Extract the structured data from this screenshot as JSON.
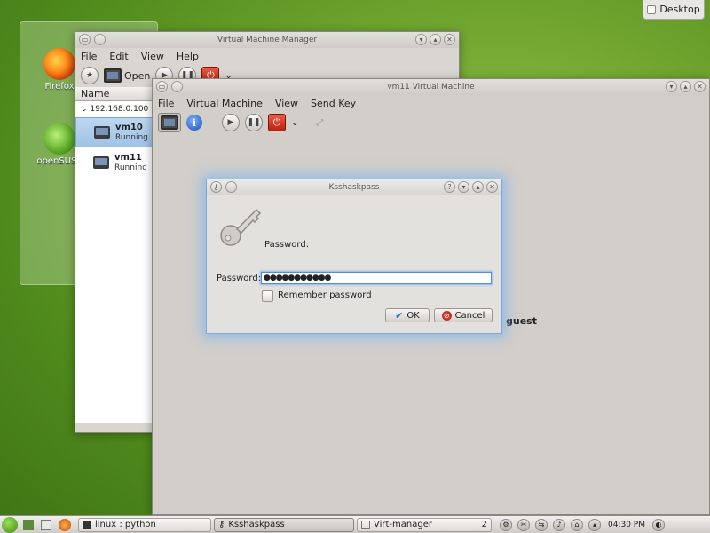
{
  "desktop": {
    "icons": [
      {
        "label": "Firefox"
      },
      {
        "label": "openSUSE"
      }
    ],
    "desktop_button": "Desktop"
  },
  "vmm": {
    "title": "Virtual Machine Manager",
    "menu": [
      "File",
      "Edit",
      "View",
      "Help"
    ],
    "toolbar_open": "Open",
    "list_header": "Name",
    "host": "192.168.0.100 (Q",
    "vms": [
      {
        "name": "vm10",
        "status": "Running"
      },
      {
        "name": "vm11",
        "status": "Running"
      }
    ]
  },
  "vm11": {
    "title": "vm11 Virtual Machine",
    "menu": [
      "File",
      "Virtual Machine",
      "View",
      "Send Key"
    ],
    "background_text": "guest"
  },
  "dialog": {
    "title": "Ksshaskpass",
    "prompt": "Password:",
    "field_label": "Password:",
    "field_value": "●●●●●●●●●●●",
    "remember_label": "Remember password",
    "ok_label": "OK",
    "cancel_label": "Cancel"
  },
  "taskbar": {
    "tasks": [
      {
        "label": "linux : python"
      },
      {
        "label": "Ksshaskpass"
      },
      {
        "label": "Virt-manager"
      }
    ],
    "task_count": "2",
    "clock": "04:30 PM"
  }
}
